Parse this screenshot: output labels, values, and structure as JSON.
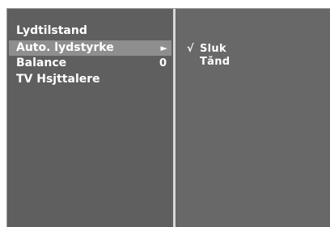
{
  "menu": {
    "title": "Lydtilstand",
    "items": [
      {
        "label": "Auto. lydstyrke",
        "arrow": "►"
      },
      {
        "label": "Balance",
        "value": "0"
      },
      {
        "label": "TV Hsjttalere"
      }
    ]
  },
  "submenu": {
    "options": [
      {
        "check": "√",
        "label": "Sluk"
      },
      {
        "check": "",
        "label": "Tǎnd"
      }
    ]
  },
  "colors": {
    "panel": "#5f5f5f",
    "selected": "#8e8e8e",
    "divider": "#d7d7d7",
    "text": "#ffffff"
  }
}
